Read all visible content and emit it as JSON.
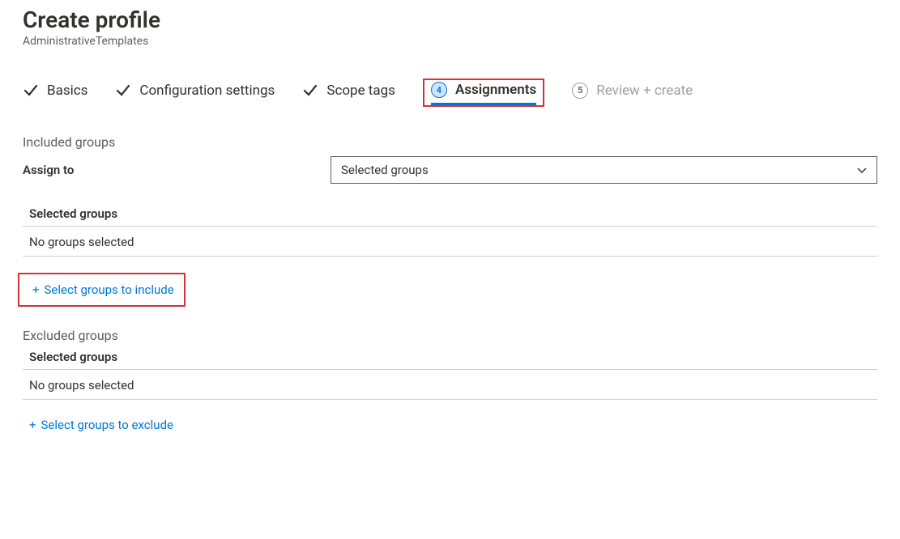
{
  "header": {
    "title": "Create profile",
    "subtitle": "AdministrativeTemplates"
  },
  "steps": {
    "basics": "Basics",
    "config": "Configuration settings",
    "scope": "Scope tags",
    "assignments_num": "4",
    "assignments": "Assignments",
    "review_num": "5",
    "review": "Review + create"
  },
  "included": {
    "section_label": "Included groups",
    "assign_to_label": "Assign to",
    "assign_to_value": "Selected groups",
    "selected_header": "Selected groups",
    "empty": "No groups selected",
    "add_link": "Select groups to include"
  },
  "excluded": {
    "section_label": "Excluded groups",
    "selected_header": "Selected groups",
    "empty": "No groups selected",
    "add_link": "Select groups to exclude"
  }
}
